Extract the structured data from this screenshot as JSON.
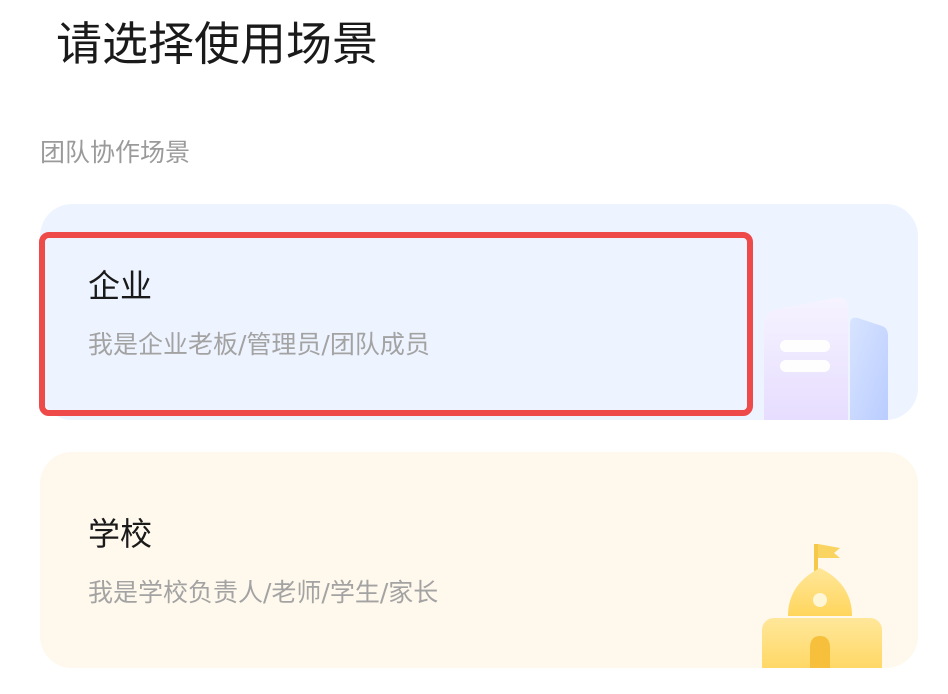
{
  "page": {
    "title": "请选择使用场景",
    "section_label": "团队协作场景"
  },
  "cards": [
    {
      "title": "企业",
      "description": "我是企业老板/管理员/团队成员",
      "icon": "office-building-icon",
      "background": "#eef4ff",
      "highlighted": true
    },
    {
      "title": "学校",
      "description": "我是学校负责人/老师/学生/家长",
      "icon": "school-building-icon",
      "background": "#fff8ec",
      "highlighted": false
    }
  ],
  "colors": {
    "highlight": "#ef4a4a",
    "title_text": "#1a1a1a",
    "muted_text": "#9a9a9a"
  }
}
